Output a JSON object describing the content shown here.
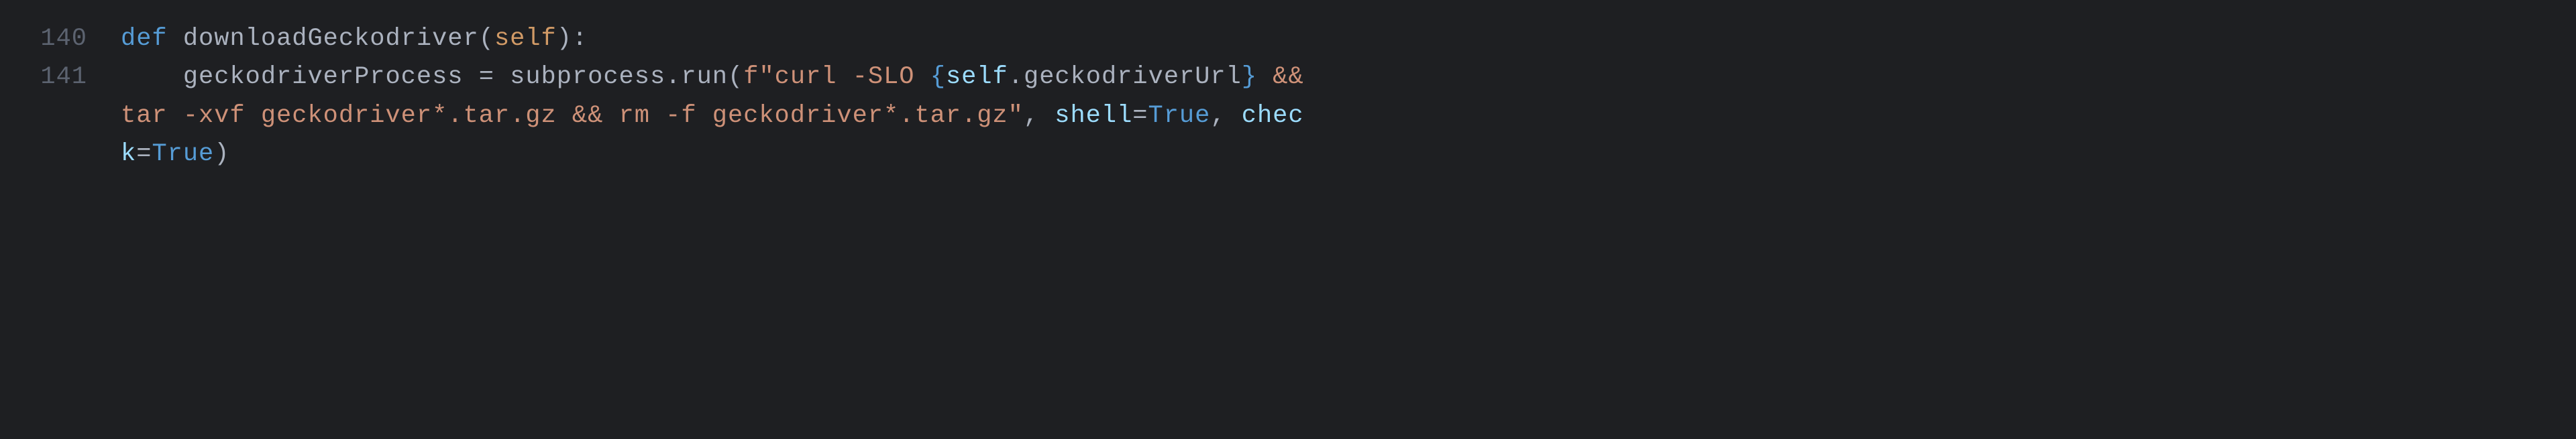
{
  "lines": {
    "ln140": "140",
    "ln141": "141"
  },
  "tokens": {
    "def": "def",
    "space": " ",
    "funcname": "downloadGeckodriver",
    "lparen": "(",
    "self": "self",
    "rparen": ")",
    "colon": ":",
    "indent": "    ",
    "var_geckodriverProcess": "geckodriverProcess",
    "eq": " = ",
    "subprocess": "subprocess",
    "dot": ".",
    "run": "run",
    "f_prefix": "f",
    "dq": "\"",
    "str1": "curl -SLO ",
    "lbrace": "{",
    "rbrace": "}",
    "interp_self": "self",
    "interp_dot": ".",
    "interp_member": "geckodriverUrl",
    "str2": " && ",
    "str3": "tar -xvf geckodriver*.tar.gz && rm -f geckodriver*.tar.gz",
    "comma_sp": ", ",
    "shell": "shell",
    "eq2": "=",
    "true": "True",
    "check_part1": "chec",
    "check_part2": "k"
  }
}
